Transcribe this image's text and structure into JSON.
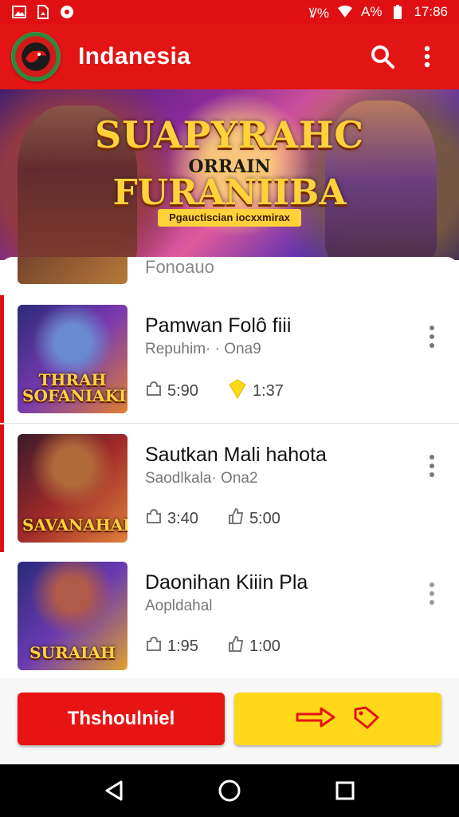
{
  "status_bar": {
    "signal_text": "Ꝟ%",
    "battery_text": "A%",
    "time": "17:86"
  },
  "app_bar": {
    "title": "Indanesia",
    "icons": [
      "logo-icon",
      "search-icon",
      "more-vert-icon"
    ]
  },
  "banner": {
    "line1": "SUAPYRAHC",
    "line2": "ORRAIN",
    "line3": "FURANIIBA",
    "tagline": "Pgauctiscian iocxxmirax"
  },
  "partial_item": {
    "title": "Fonoauo"
  },
  "games": [
    {
      "title": "Pamwan Folô fiii",
      "subtitle": "Repuhim· · Ona9",
      "thumb_caption": "THRAH SOFANIAKI",
      "stat1_icon": "puzzle-icon",
      "stat1": "5:90",
      "stat2_icon": "star-icon",
      "stat2": "1:37",
      "highlight_color": "#ffd81a"
    },
    {
      "title": "Sautkan Mali hahota",
      "subtitle": "Saodlkala· Ona2",
      "thumb_caption": "SAVANAHAR",
      "stat1_icon": "puzzle-icon",
      "stat1": "3:40",
      "stat2_icon": "thumbs-up-icon",
      "stat2": "5:00"
    },
    {
      "title": "Daonihan Kiiin Pla",
      "subtitle": "Aopldahal",
      "thumb_caption": "SURAIAH",
      "stat1_icon": "puzzle-icon",
      "stat1": "1:95",
      "stat2_icon": "thumbs-up-icon",
      "stat2": "1:00"
    }
  ],
  "buttons": {
    "primary_label": "Thshoulniel",
    "secondary_icons": [
      "arrow-icon",
      "tag-icon"
    ]
  },
  "colors": {
    "brand_red": "#e31414",
    "accent_yellow": "#ffd81a"
  },
  "nav": [
    "back-icon",
    "home-icon",
    "recents-icon"
  ]
}
